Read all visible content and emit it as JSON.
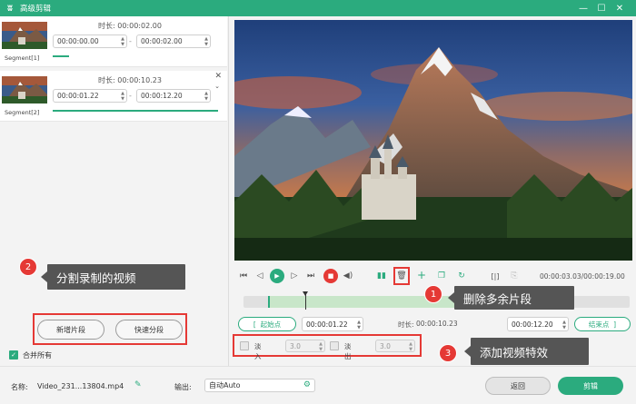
{
  "window": {
    "title": "高级剪辑",
    "controls": [
      "—",
      "☐",
      "✕"
    ]
  },
  "segments": [
    {
      "label": "Segment[1]",
      "duration_label": "时长:",
      "duration": "00:00:02.00",
      "start": "00:00:00.00",
      "end": "00:00:02.00",
      "tilde": "-"
    },
    {
      "label": "Segment[2]",
      "duration_label": "时长:",
      "duration": "00:00:10.23",
      "start": "00:00:01.22",
      "end": "00:00:12.20",
      "tilde": "-"
    }
  ],
  "left_actions": {
    "new_segment": "新增片段",
    "quick_split": "快速分段",
    "merge_all": "合并所有"
  },
  "player": {
    "time_readout": "00:00:03.03/00:00:19.00",
    "progress_fraction": 0.16
  },
  "range": {
    "start_button": "起始点",
    "start_time": "00:00:01.22",
    "duration_label": "时长:",
    "duration": "00:00:10.23",
    "end_time": "00:00:12.20",
    "end_button": "结束点",
    "bracket_left": "[",
    "bracket_right": "]"
  },
  "effects": {
    "fade_in_label": "淡入",
    "fade_in_value": "3.0",
    "fade_out_label": "淡出",
    "fade_out_value": "3.0"
  },
  "callouts": [
    {
      "num": "1",
      "text": "删除多余片段"
    },
    {
      "num": "2",
      "text": "分割录制的视频"
    },
    {
      "num": "3",
      "text": "添加视频特效"
    }
  ],
  "bottom": {
    "name_label": "名称:",
    "name_value": "Video_231...13804.mp4",
    "output_label": "输出:",
    "output_value": "自动Auto",
    "back_button": "返回",
    "cut_button": "剪辑"
  },
  "colors": {
    "accent": "#2bab7e",
    "callout_red": "#e53935",
    "callout_bubble": "#555555"
  },
  "icons": {
    "logo": "rabbit-logo-icon",
    "edit": "pencil-icon",
    "settings": "gear-icon"
  }
}
